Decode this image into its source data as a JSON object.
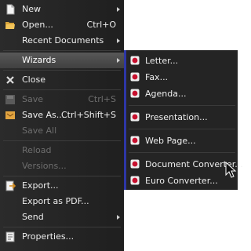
{
  "menu": {
    "new": {
      "label": "New"
    },
    "open": {
      "label": "Open...",
      "shortcut": "Ctrl+O"
    },
    "recent": {
      "label": "Recent Documents"
    },
    "wizards": {
      "label": "Wizards"
    },
    "close": {
      "label": "Close"
    },
    "save": {
      "label": "Save",
      "shortcut": "Ctrl+S"
    },
    "save_as": {
      "label": "Save As...",
      "shortcut": "Ctrl+Shift+S"
    },
    "save_all": {
      "label": "Save All"
    },
    "reload": {
      "label": "Reload"
    },
    "versions": {
      "label": "Versions..."
    },
    "export": {
      "label": "Export..."
    },
    "export_pdf": {
      "label": "Export as PDF..."
    },
    "send": {
      "label": "Send"
    },
    "properties": {
      "label": "Properties..."
    }
  },
  "submenu": {
    "items": [
      {
        "label": "Letter..."
      },
      {
        "label": "Fax..."
      },
      {
        "label": "Agenda..."
      },
      {
        "label": "Presentation..."
      },
      {
        "label": "Web Page..."
      },
      {
        "label": "Document Converter..."
      },
      {
        "label": "Euro Converter..."
      }
    ]
  },
  "icons": {
    "wizard_item": "red-circle-icon",
    "accent": "#2d36a6",
    "highlight": "#505050"
  }
}
